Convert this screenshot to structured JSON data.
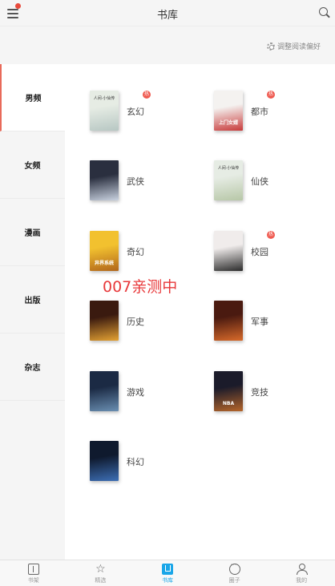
{
  "header": {
    "title": "书库",
    "prefs_label": "调整阅读偏好"
  },
  "sidebar": {
    "items": [
      {
        "label": "男频",
        "active": true
      },
      {
        "label": "女频"
      },
      {
        "label": "漫画"
      },
      {
        "label": "出版"
      },
      {
        "label": "杂志"
      }
    ]
  },
  "categories": [
    {
      "label": "玄幻",
      "badge": "热",
      "cover_title": "人间·小仙传",
      "cover_text": "",
      "cover_colors": [
        "#e6ece4",
        "#b7c7c3"
      ]
    },
    {
      "label": "都市",
      "badge": "热",
      "cover_title": "",
      "cover_text": "上门女婿",
      "cover_colors": [
        "#f4f2f0",
        "#c83a3a"
      ]
    },
    {
      "label": "武侠",
      "badge": "",
      "cover_title": "",
      "cover_text": "",
      "cover_colors": [
        "#2a2f3f",
        "#c9d2e0"
      ]
    },
    {
      "label": "仙侠",
      "badge": "",
      "cover_title": "人间·小仙传",
      "cover_text": "",
      "cover_colors": [
        "#e6ece4",
        "#b7c7a7"
      ]
    },
    {
      "label": "奇幻",
      "badge": "",
      "cover_title": "",
      "cover_text": "异界系统",
      "cover_colors": [
        "#f2c12f",
        "#b1661b"
      ]
    },
    {
      "label": "校园",
      "badge": "热",
      "cover_title": "",
      "cover_text": "",
      "cover_colors": [
        "#f0eceb",
        "#2b2b2b"
      ]
    },
    {
      "label": "历史",
      "badge": "",
      "cover_title": "",
      "cover_text": "",
      "cover_colors": [
        "#3a1a0f",
        "#e4a233"
      ]
    },
    {
      "label": "军事",
      "badge": "",
      "cover_title": "",
      "cover_text": "",
      "cover_colors": [
        "#4a1a10",
        "#d86a2a"
      ]
    },
    {
      "label": "游戏",
      "badge": "",
      "cover_title": "",
      "cover_text": "",
      "cover_colors": [
        "#1b2a44",
        "#6a8fb2"
      ]
    },
    {
      "label": "竞技",
      "badge": "",
      "cover_title": "",
      "cover_text": "NBA",
      "cover_colors": [
        "#1b1b2a",
        "#b5652a"
      ]
    },
    {
      "label": "科幻",
      "badge": "",
      "cover_title": "",
      "cover_text": "",
      "cover_colors": [
        "#0f1a2e",
        "#3d6fb5"
      ]
    }
  ],
  "watermark": "007亲测中",
  "tabbar": {
    "items": [
      {
        "label": "书架",
        "icon": "bookshelf-icon"
      },
      {
        "label": "精选",
        "icon": "star-icon"
      },
      {
        "label": "书库",
        "icon": "library-icon",
        "active": true
      },
      {
        "label": "圈子",
        "icon": "chat-icon"
      },
      {
        "label": "我的",
        "icon": "user-icon"
      }
    ]
  },
  "colors": {
    "accent": "#1aa6e8",
    "badge": "#ef5a50",
    "watermark": "#e8383a"
  }
}
